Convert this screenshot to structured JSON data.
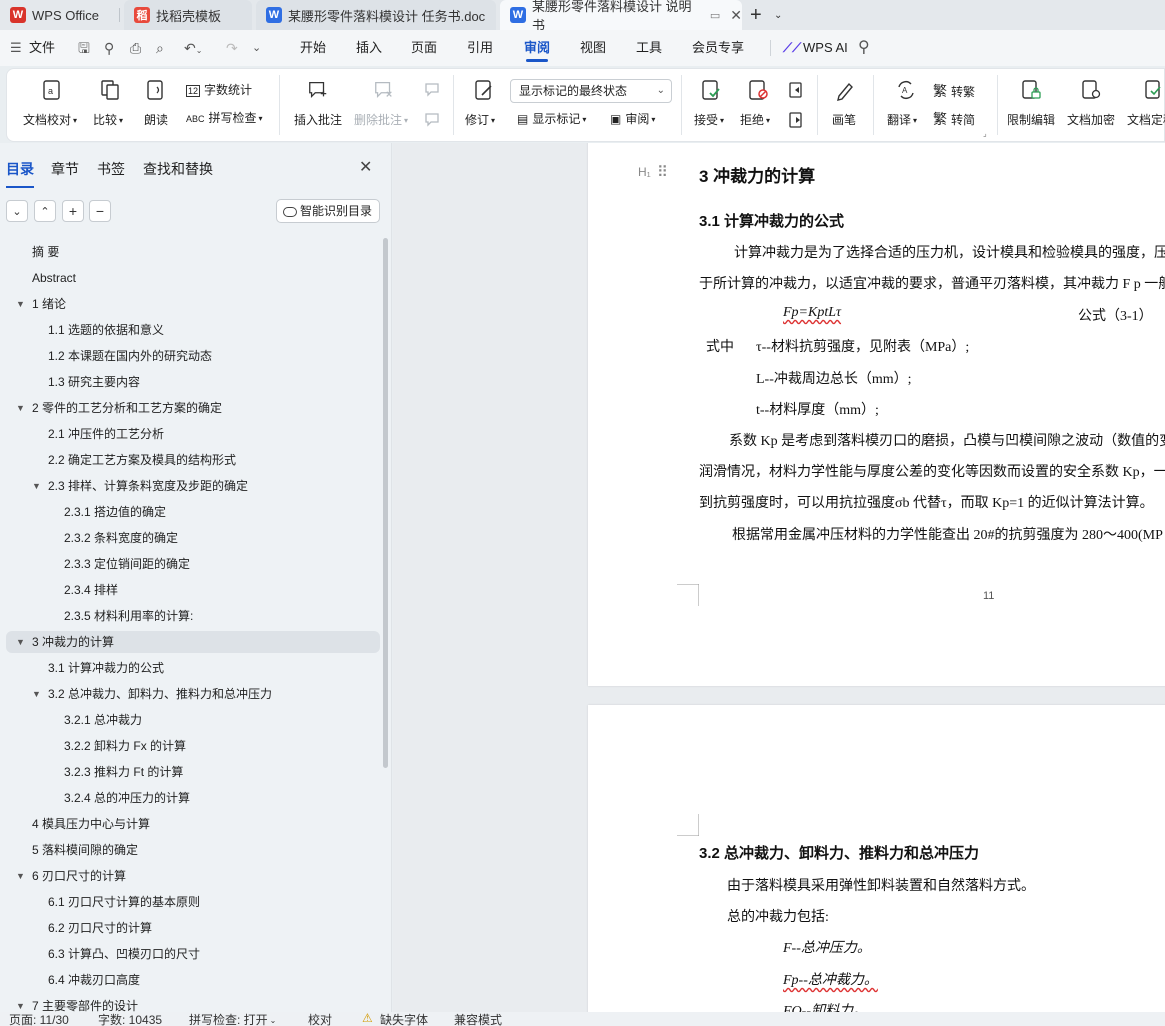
{
  "tabs": [
    {
      "label": "WPS Office",
      "icon": "wps-logo-icon",
      "color": "#d9342b"
    },
    {
      "label": "找稻壳模板",
      "icon": "docer-icon",
      "color": "#e84a3c"
    },
    {
      "label": "某腰形零件落料模设计 任务书.doc",
      "icon": "word-doc-icon",
      "color": "#2f6ee3"
    },
    {
      "label": "某腰形零件落料模设计 说明书",
      "icon": "word-doc-icon",
      "color": "#2f6ee3"
    }
  ],
  "menu": {
    "file": "文件",
    "items": [
      "开始",
      "插入",
      "页面",
      "引用",
      "审阅",
      "视图",
      "工具",
      "会员专享"
    ],
    "active": "审阅",
    "ai": "WPS AI"
  },
  "ribbon": {
    "proof": "文档校对",
    "compare": "比较",
    "read_aloud": "朗读",
    "word_count": "字数统计",
    "spell_check": "拼写检查",
    "insert_comment": "插入批注",
    "delete_comment": "删除批注",
    "revise": "修订",
    "markup_state": "显示标记的最终状态",
    "show_markup": "显示标记",
    "review": "审阅",
    "accept": "接受",
    "reject": "拒绝",
    "pen": "画笔",
    "translate": "翻译",
    "to_traditional": "转繁",
    "to_simplified": "转简",
    "restrict_edit": "限制编辑",
    "encrypt": "文档加密",
    "finalize": "文档定稿"
  },
  "sidebar": {
    "tabs": [
      "目录",
      "章节",
      "书签",
      "查找和替换"
    ],
    "smart_toc": "智能识别目录",
    "items": [
      {
        "label": "摘  要",
        "level": 1,
        "arrow": ""
      },
      {
        "label": "Abstract",
        "level": 1,
        "arrow": ""
      },
      {
        "label": "1  绪论",
        "level": 1,
        "arrow": "down"
      },
      {
        "label": "1.1  选题的依据和意义",
        "level": 2,
        "arrow": ""
      },
      {
        "label": "1.2  本课题在国内外的研究动态",
        "level": 2,
        "arrow": ""
      },
      {
        "label": "1.3  研究主要内容",
        "level": 2,
        "arrow": ""
      },
      {
        "label": "2  零件的工艺分析和工艺方案的确定",
        "level": 1,
        "arrow": "down"
      },
      {
        "label": "2.1  冲压件的工艺分析",
        "level": 2,
        "arrow": ""
      },
      {
        "label": "2.2  确定工艺方案及模具的结构形式",
        "level": 2,
        "arrow": ""
      },
      {
        "label": "2.3  排样、计算条料宽度及步距的确定",
        "level": 2,
        "arrow": "down"
      },
      {
        "label": "2.3.1  搭边值的确定",
        "level": 3,
        "arrow": ""
      },
      {
        "label": "2.3.2  条料宽度的确定",
        "level": 3,
        "arrow": ""
      },
      {
        "label": "2.3.3  定位销间距的确定",
        "level": 3,
        "arrow": ""
      },
      {
        "label": "2.3.4  排样",
        "level": 3,
        "arrow": ""
      },
      {
        "label": "2.3.5  材料利用率的计算:",
        "level": 3,
        "arrow": ""
      },
      {
        "label": "3  冲裁力的计算",
        "level": 1,
        "arrow": "down",
        "selected": true
      },
      {
        "label": "3.1  计算冲裁力的公式",
        "level": 2,
        "arrow": ""
      },
      {
        "label": "3.2  总冲裁力、卸料力、推料力和总冲压力",
        "level": 2,
        "arrow": "down"
      },
      {
        "label": "3.2.1  总冲裁力",
        "level": 3,
        "arrow": ""
      },
      {
        "label": "3.2.2  卸料力 Fx 的计算",
        "level": 3,
        "arrow": ""
      },
      {
        "label": "3.2.3  推料力 Ft 的计算",
        "level": 3,
        "arrow": ""
      },
      {
        "label": "3.2.4  总的冲压力的计算",
        "level": 3,
        "arrow": ""
      },
      {
        "label": "4  模具压力中心与计算",
        "level": 1,
        "arrow": ""
      },
      {
        "label": "5  落料模间隙的确定",
        "level": 1,
        "arrow": ""
      },
      {
        "label": "6  刃口尺寸的计算",
        "level": 1,
        "arrow": "down"
      },
      {
        "label": "6.1  刃口尺寸计算的基本原则",
        "level": 2,
        "arrow": ""
      },
      {
        "label": "6.2  刃口尺寸的计算",
        "level": 2,
        "arrow": ""
      },
      {
        "label": "6.3  计算凸、凹模刃口的尺寸",
        "level": 2,
        "arrow": ""
      },
      {
        "label": "6.4  冲裁刃口高度",
        "level": 2,
        "arrow": ""
      },
      {
        "label": "7  主要零部件的设计",
        "level": 1,
        "arrow": "down"
      }
    ]
  },
  "document": {
    "heading_marker": "H₁",
    "h1": "3  冲裁力的计算",
    "h2_1": "3.1  计算冲裁力的公式",
    "p1_line1": "计算冲裁力是为了选择合适的压力机，设计模具和检验模具的强度，压",
    "p1_line2": "于所计算的冲裁力，以适宜冲裁的要求，普通平刃落料模，其冲裁力 F p 一般",
    "formula": "Fp=KptLτ",
    "formula_label": "公式（3-1）",
    "where": "式中",
    "def_tau": "τ--材料抗剪强度，见附表（MPa）;",
    "def_L": "L--冲裁周边总长（mm）;",
    "def_t": "t--材料厚度（mm）;",
    "p2_line1": "系数 Kp 是考虑到落料模刃口的磨损，凸模与凹模间隙之波动（数值的变",
    "p2_line2": "润滑情况，材料力学性能与厚度公差的变化等因数而设置的安全系数 Kp，一",
    "p2_line3": "到抗剪强度时，可以用抗拉强度σb 代替τ，而取 Kp=1 的近似计算法计算。",
    "p3": "根据常用金属冲压材料的力学性能查出  20#的抗剪强度为 280～400(MP",
    "page_number": "11",
    "h2_2": "3.2  总冲裁力、卸料力、推料力和总冲压力",
    "p4": "由于落料模具采用弹性卸料装置和自然落料方式。",
    "p5": "总的冲裁力包括:",
    "def_F": "F--总冲压力。",
    "def_Fp": "Fp--总冲裁力。",
    "def_FQ": "FQ--卸料力。"
  },
  "status": {
    "page": "页面: 11/30",
    "words": "字数: 10435",
    "spell": "拼写检查: 打开",
    "proof": "校对",
    "missing_font": "缺失字体",
    "compat": "兼容模式"
  }
}
